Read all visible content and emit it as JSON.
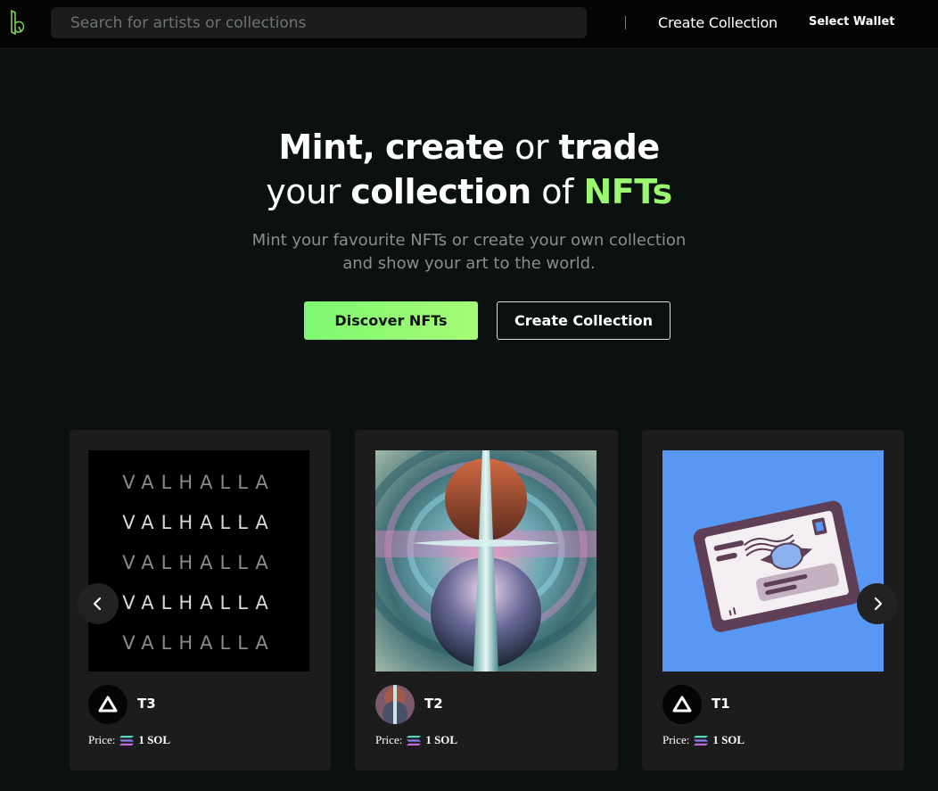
{
  "header": {
    "search_placeholder": "Search for artists or collections",
    "create_collection": "Create Collection",
    "select_wallet": "Select Wallet"
  },
  "hero": {
    "line1": {
      "mint": "Mint,",
      "create": "create",
      "or": "or",
      "trade": "trade"
    },
    "line2": {
      "your": "your",
      "collection": "collection",
      "of": "of",
      "nfts": "NFTs"
    },
    "subtitle_line1": "Mint your favourite NFTs or create your own collection",
    "subtitle_line2": "and show your art to the world.",
    "discover_button": "Discover NFTs",
    "create_button": "Create Collection"
  },
  "colors": {
    "accent_green": "#99f86f",
    "background": "#0b110e",
    "card_bg": "#1c1c1c",
    "t1_art_bg": "#5897f4"
  },
  "cards": [
    {
      "name": "T3",
      "art_text": [
        "VALHALLA",
        "VALHALLA",
        "VALHALLA",
        "VALHALLA",
        "VALHALLA"
      ],
      "price_label": "Price:",
      "price_value": "1 SOL",
      "avatar_icon": "triangle-logo-icon"
    },
    {
      "name": "T2",
      "price_label": "Price:",
      "price_value": "1 SOL",
      "avatar_icon": "abstract-art-avatar"
    },
    {
      "name": "T1",
      "price_label": "Price:",
      "price_value": "1 SOL",
      "avatar_icon": "triangle-logo-icon"
    }
  ],
  "carousel": {
    "prev_icon": "chevron-left-icon",
    "next_icon": "chevron-right-icon"
  }
}
